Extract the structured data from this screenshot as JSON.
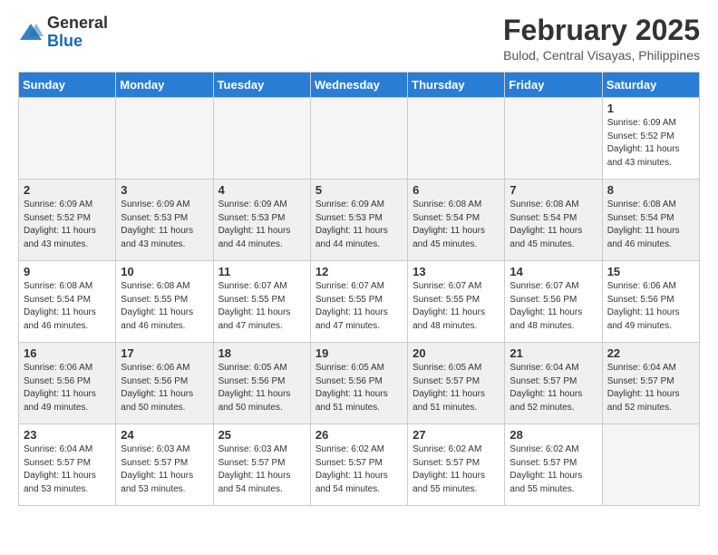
{
  "header": {
    "logo_general": "General",
    "logo_blue": "Blue",
    "month_year": "February 2025",
    "location": "Bulod, Central Visayas, Philippines"
  },
  "days_of_week": [
    "Sunday",
    "Monday",
    "Tuesday",
    "Wednesday",
    "Thursday",
    "Friday",
    "Saturday"
  ],
  "weeks": [
    [
      {
        "day": "",
        "info": ""
      },
      {
        "day": "",
        "info": ""
      },
      {
        "day": "",
        "info": ""
      },
      {
        "day": "",
        "info": ""
      },
      {
        "day": "",
        "info": ""
      },
      {
        "day": "",
        "info": ""
      },
      {
        "day": "1",
        "info": "Sunrise: 6:09 AM\nSunset: 5:52 PM\nDaylight: 11 hours\nand 43 minutes."
      }
    ],
    [
      {
        "day": "2",
        "info": "Sunrise: 6:09 AM\nSunset: 5:52 PM\nDaylight: 11 hours\nand 43 minutes."
      },
      {
        "day": "3",
        "info": "Sunrise: 6:09 AM\nSunset: 5:53 PM\nDaylight: 11 hours\nand 43 minutes."
      },
      {
        "day": "4",
        "info": "Sunrise: 6:09 AM\nSunset: 5:53 PM\nDaylight: 11 hours\nand 44 minutes."
      },
      {
        "day": "5",
        "info": "Sunrise: 6:09 AM\nSunset: 5:53 PM\nDaylight: 11 hours\nand 44 minutes."
      },
      {
        "day": "6",
        "info": "Sunrise: 6:08 AM\nSunset: 5:54 PM\nDaylight: 11 hours\nand 45 minutes."
      },
      {
        "day": "7",
        "info": "Sunrise: 6:08 AM\nSunset: 5:54 PM\nDaylight: 11 hours\nand 45 minutes."
      },
      {
        "day": "8",
        "info": "Sunrise: 6:08 AM\nSunset: 5:54 PM\nDaylight: 11 hours\nand 46 minutes."
      }
    ],
    [
      {
        "day": "9",
        "info": "Sunrise: 6:08 AM\nSunset: 5:54 PM\nDaylight: 11 hours\nand 46 minutes."
      },
      {
        "day": "10",
        "info": "Sunrise: 6:08 AM\nSunset: 5:55 PM\nDaylight: 11 hours\nand 46 minutes."
      },
      {
        "day": "11",
        "info": "Sunrise: 6:07 AM\nSunset: 5:55 PM\nDaylight: 11 hours\nand 47 minutes."
      },
      {
        "day": "12",
        "info": "Sunrise: 6:07 AM\nSunset: 5:55 PM\nDaylight: 11 hours\nand 47 minutes."
      },
      {
        "day": "13",
        "info": "Sunrise: 6:07 AM\nSunset: 5:55 PM\nDaylight: 11 hours\nand 48 minutes."
      },
      {
        "day": "14",
        "info": "Sunrise: 6:07 AM\nSunset: 5:56 PM\nDaylight: 11 hours\nand 48 minutes."
      },
      {
        "day": "15",
        "info": "Sunrise: 6:06 AM\nSunset: 5:56 PM\nDaylight: 11 hours\nand 49 minutes."
      }
    ],
    [
      {
        "day": "16",
        "info": "Sunrise: 6:06 AM\nSunset: 5:56 PM\nDaylight: 11 hours\nand 49 minutes."
      },
      {
        "day": "17",
        "info": "Sunrise: 6:06 AM\nSunset: 5:56 PM\nDaylight: 11 hours\nand 50 minutes."
      },
      {
        "day": "18",
        "info": "Sunrise: 6:05 AM\nSunset: 5:56 PM\nDaylight: 11 hours\nand 50 minutes."
      },
      {
        "day": "19",
        "info": "Sunrise: 6:05 AM\nSunset: 5:56 PM\nDaylight: 11 hours\nand 51 minutes."
      },
      {
        "day": "20",
        "info": "Sunrise: 6:05 AM\nSunset: 5:57 PM\nDaylight: 11 hours\nand 51 minutes."
      },
      {
        "day": "21",
        "info": "Sunrise: 6:04 AM\nSunset: 5:57 PM\nDaylight: 11 hours\nand 52 minutes."
      },
      {
        "day": "22",
        "info": "Sunrise: 6:04 AM\nSunset: 5:57 PM\nDaylight: 11 hours\nand 52 minutes."
      }
    ],
    [
      {
        "day": "23",
        "info": "Sunrise: 6:04 AM\nSunset: 5:57 PM\nDaylight: 11 hours\nand 53 minutes."
      },
      {
        "day": "24",
        "info": "Sunrise: 6:03 AM\nSunset: 5:57 PM\nDaylight: 11 hours\nand 53 minutes."
      },
      {
        "day": "25",
        "info": "Sunrise: 6:03 AM\nSunset: 5:57 PM\nDaylight: 11 hours\nand 54 minutes."
      },
      {
        "day": "26",
        "info": "Sunrise: 6:02 AM\nSunset: 5:57 PM\nDaylight: 11 hours\nand 54 minutes."
      },
      {
        "day": "27",
        "info": "Sunrise: 6:02 AM\nSunset: 5:57 PM\nDaylight: 11 hours\nand 55 minutes."
      },
      {
        "day": "28",
        "info": "Sunrise: 6:02 AM\nSunset: 5:57 PM\nDaylight: 11 hours\nand 55 minutes."
      },
      {
        "day": "",
        "info": ""
      }
    ]
  ]
}
